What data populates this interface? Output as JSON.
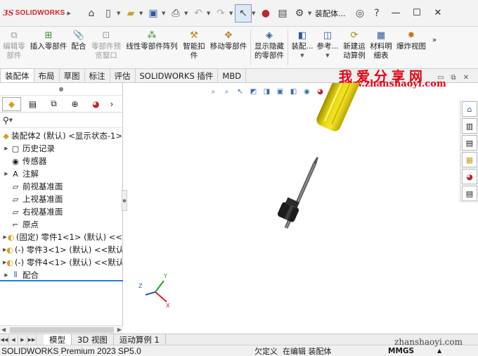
{
  "titlebar": {
    "logo_ds": "3S",
    "logo_text": "SOLIDWORKS",
    "doc_title": "装配体...",
    "icons": [
      "home-icon",
      "new-document-icon",
      "open-folder-icon",
      "save-icon",
      "print-icon",
      "undo-icon",
      "redo-icon",
      "select-arrow-icon",
      "traffic-light-icon",
      "file-properties-icon",
      "options-gear-icon",
      "search-user-icon",
      "help-icon",
      "minimize-icon",
      "maximize-icon",
      "close-icon"
    ]
  },
  "ribbon": {
    "items": [
      {
        "label_line1": "编辑零",
        "label_line2": "部件",
        "icon": "edit-component-icon",
        "disabled": true
      },
      {
        "label_line1": "插入零部件",
        "label_line2": "",
        "icon": "insert-component-icon",
        "disabled": false
      },
      {
        "label_line1": "配合",
        "label_line2": "",
        "icon": "mate-icon",
        "disabled": false
      },
      {
        "label_line1": "零部件预",
        "label_line2": "览窗口",
        "icon": "component-preview-icon",
        "disabled": true
      },
      {
        "label_line1": "线性零部件阵列",
        "label_line2": "",
        "icon": "linear-pattern-icon",
        "disabled": false
      },
      {
        "label_line1": "智能扣",
        "label_line2": "件",
        "icon": "smart-fasteners-icon",
        "disabled": false
      },
      {
        "label_line1": "移动零部件",
        "label_line2": "",
        "icon": "move-component-icon",
        "disabled": false
      },
      {
        "label_line1": "显示隐藏",
        "label_line2": "的零部件",
        "icon": "show-hidden-icon",
        "disabled": false
      },
      {
        "label_line1": "装配...",
        "label_line2": "",
        "icon": "assembly-features-icon",
        "disabled": false
      },
      {
        "label_line1": "参考...",
        "label_line2": "",
        "icon": "reference-geometry-icon",
        "disabled": false
      },
      {
        "label_line1": "新建运",
        "label_line2": "动算例",
        "icon": "new-motion-study-icon",
        "disabled": false
      },
      {
        "label_line1": "材料明",
        "label_line2": "细表",
        "icon": "bom-icon",
        "disabled": false
      },
      {
        "label_line1": "爆炸视图",
        "label_line2": "",
        "icon": "exploded-view-icon",
        "disabled": false
      }
    ],
    "overflow": "»"
  },
  "tabs": [
    "装配体",
    "布局",
    "草图",
    "标注",
    "评估",
    "SOLIDWORKS 插件",
    "MBD"
  ],
  "watermark": {
    "cn": "我爱分享网",
    "url": "www.zhanshaoyi.com",
    "bottom": "zhanshaoyi.com"
  },
  "featuremanager": {
    "filter_icon": "filter-icon",
    "tabs": [
      "featuremanager-tree-icon",
      "propertymanager-icon",
      "configurationmanager-icon",
      "dimxpert-icon",
      "display-manager-icon"
    ],
    "tree": [
      {
        "label": "装配体2 (默认) <显示状态-1>",
        "icon": "assembly-icon",
        "expander": "",
        "indent": 0
      },
      {
        "label": "历史记录",
        "icon": "history-icon",
        "expander": "▶",
        "indent": 1
      },
      {
        "label": "传感器",
        "icon": "sensor-icon",
        "expander": "",
        "indent": 1
      },
      {
        "label": "注解",
        "icon": "annotation-icon",
        "expander": "▶",
        "indent": 1
      },
      {
        "label": "前视基准面",
        "icon": "plane-icon",
        "expander": "",
        "indent": 1
      },
      {
        "label": "上视基准面",
        "icon": "plane-icon",
        "expander": "",
        "indent": 1
      },
      {
        "label": "右视基准面",
        "icon": "plane-icon",
        "expander": "",
        "indent": 1
      },
      {
        "label": "原点",
        "icon": "origin-icon",
        "expander": "",
        "indent": 1
      },
      {
        "label": "(固定) 零件1<1> (默认) <<",
        "icon": "part-icon",
        "expander": "▶",
        "indent": 1
      },
      {
        "label": "(-) 零件3<1> (默认) <<默认",
        "icon": "part-icon",
        "expander": "▶",
        "indent": 1
      },
      {
        "label": "(-) 零件4<1> (默认) <<默认",
        "icon": "part-icon",
        "expander": "▶",
        "indent": 1
      },
      {
        "label": "配合",
        "icon": "mates-folder-icon",
        "expander": "▶",
        "indent": 1
      }
    ]
  },
  "graphics": {
    "triad": {
      "x": "X",
      "y": "Y",
      "z": "Z"
    },
    "model_colors": {
      "handle": "#f2e21a",
      "collar": "#1a1a1a",
      "shaft": "#6e6e6e"
    }
  },
  "bottom_tabs": [
    "模型",
    "3D 视图",
    "运动算例 1"
  ],
  "status": {
    "app": "SOLIDWORKS Premium 2023 SP5.0",
    "define": "欠定义",
    "editing": "在编辑 装配体",
    "units": "MMGS"
  }
}
